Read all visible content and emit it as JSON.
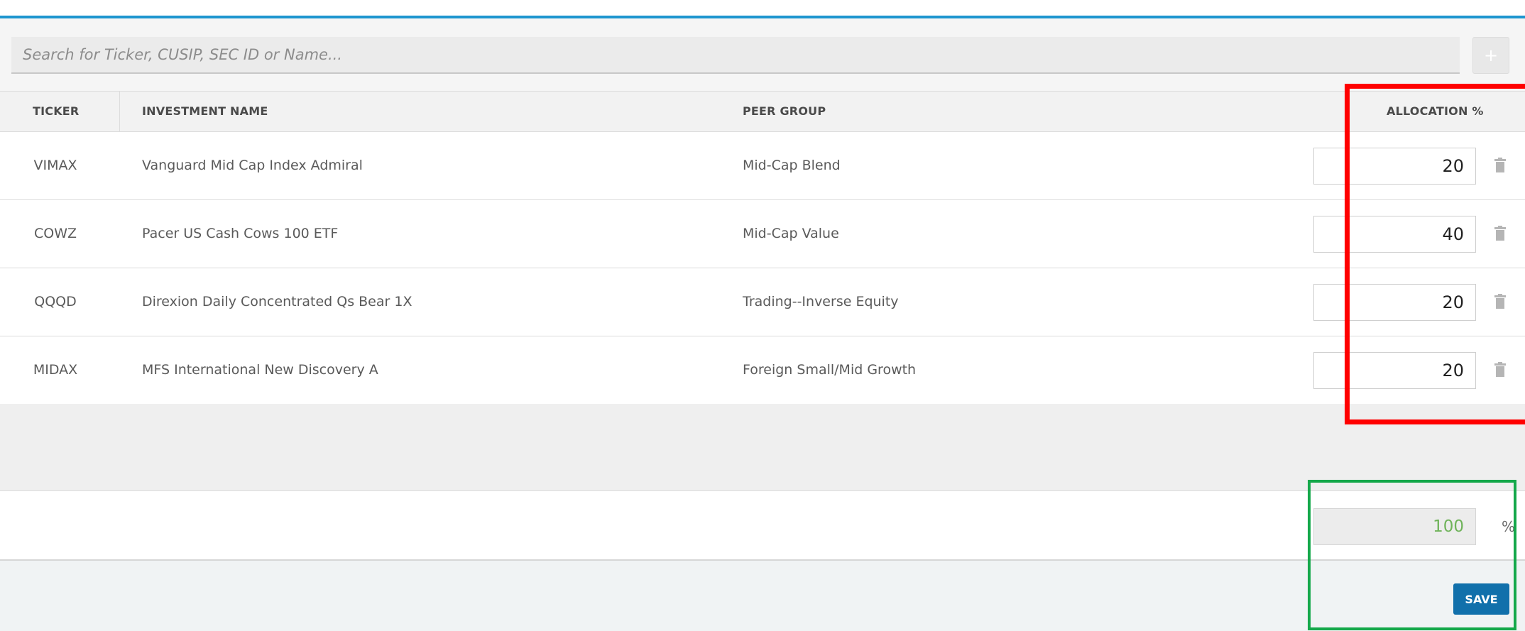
{
  "search": {
    "placeholder": "Search for Ticker, CUSIP, SEC ID or Name...",
    "add_label": "+"
  },
  "table": {
    "columns": {
      "ticker": "TICKER",
      "name": "INVESTMENT NAME",
      "peer_group": "PEER GROUP",
      "allocation": "ALLOCATION %"
    },
    "rows": [
      {
        "ticker": "VIMAX",
        "name": "Vanguard Mid Cap Index Admiral",
        "peer_group": "Mid-Cap Blend",
        "allocation": "20"
      },
      {
        "ticker": "COWZ",
        "name": "Pacer US Cash Cows 100 ETF",
        "peer_group": "Mid-Cap Value",
        "allocation": "40"
      },
      {
        "ticker": "QQQD",
        "name": "Direxion Daily Concentrated Qs Bear 1X",
        "peer_group": "Trading--Inverse Equity",
        "allocation": "20"
      },
      {
        "ticker": "MIDAX",
        "name": "MFS International New Discovery A",
        "peer_group": "Foreign Small/Mid Growth",
        "allocation": "20"
      }
    ]
  },
  "total": {
    "value": "100",
    "suffix": "%"
  },
  "footer": {
    "save_label": "SAVE"
  },
  "icons": {
    "row_action": "trash-icon",
    "accent_color": "#1e96cf",
    "save_color": "#1170ab",
    "total_color": "#6fb35a"
  }
}
